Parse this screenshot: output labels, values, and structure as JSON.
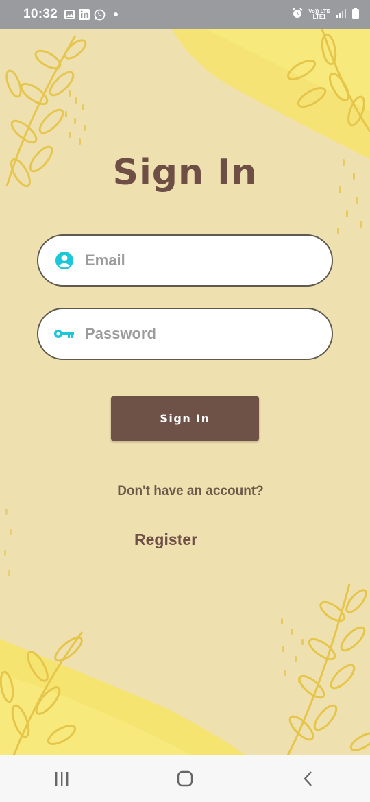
{
  "status_bar": {
    "time": "10:32",
    "left_icons": [
      "image-icon",
      "linkedin-icon",
      "whatsapp-icon",
      "dot-icon"
    ],
    "network_label_top": "Vo)) LTE",
    "network_label_bottom": "LTE1",
    "right_icons": [
      "alarm-icon",
      "signal-icon",
      "battery-icon"
    ]
  },
  "screen": {
    "title": "Sign In",
    "email_field": {
      "placeholder": "Email",
      "value": "",
      "icon": "person-icon",
      "icon_color": "#1bc7d9"
    },
    "password_field": {
      "placeholder": "Password",
      "value": "",
      "icon": "key-icon",
      "icon_color": "#1bc7d9"
    },
    "sign_in_button": "Sign In",
    "no_account_text": "Don't have an account?",
    "register_link": "Register",
    "colors": {
      "background": "#efe0b0",
      "accent": "#6e5248",
      "leaf": "#e8c94c",
      "stripe": "#f6e773"
    }
  },
  "nav_bar": {
    "buttons": [
      "recent-apps-icon",
      "home-icon",
      "back-icon"
    ]
  }
}
